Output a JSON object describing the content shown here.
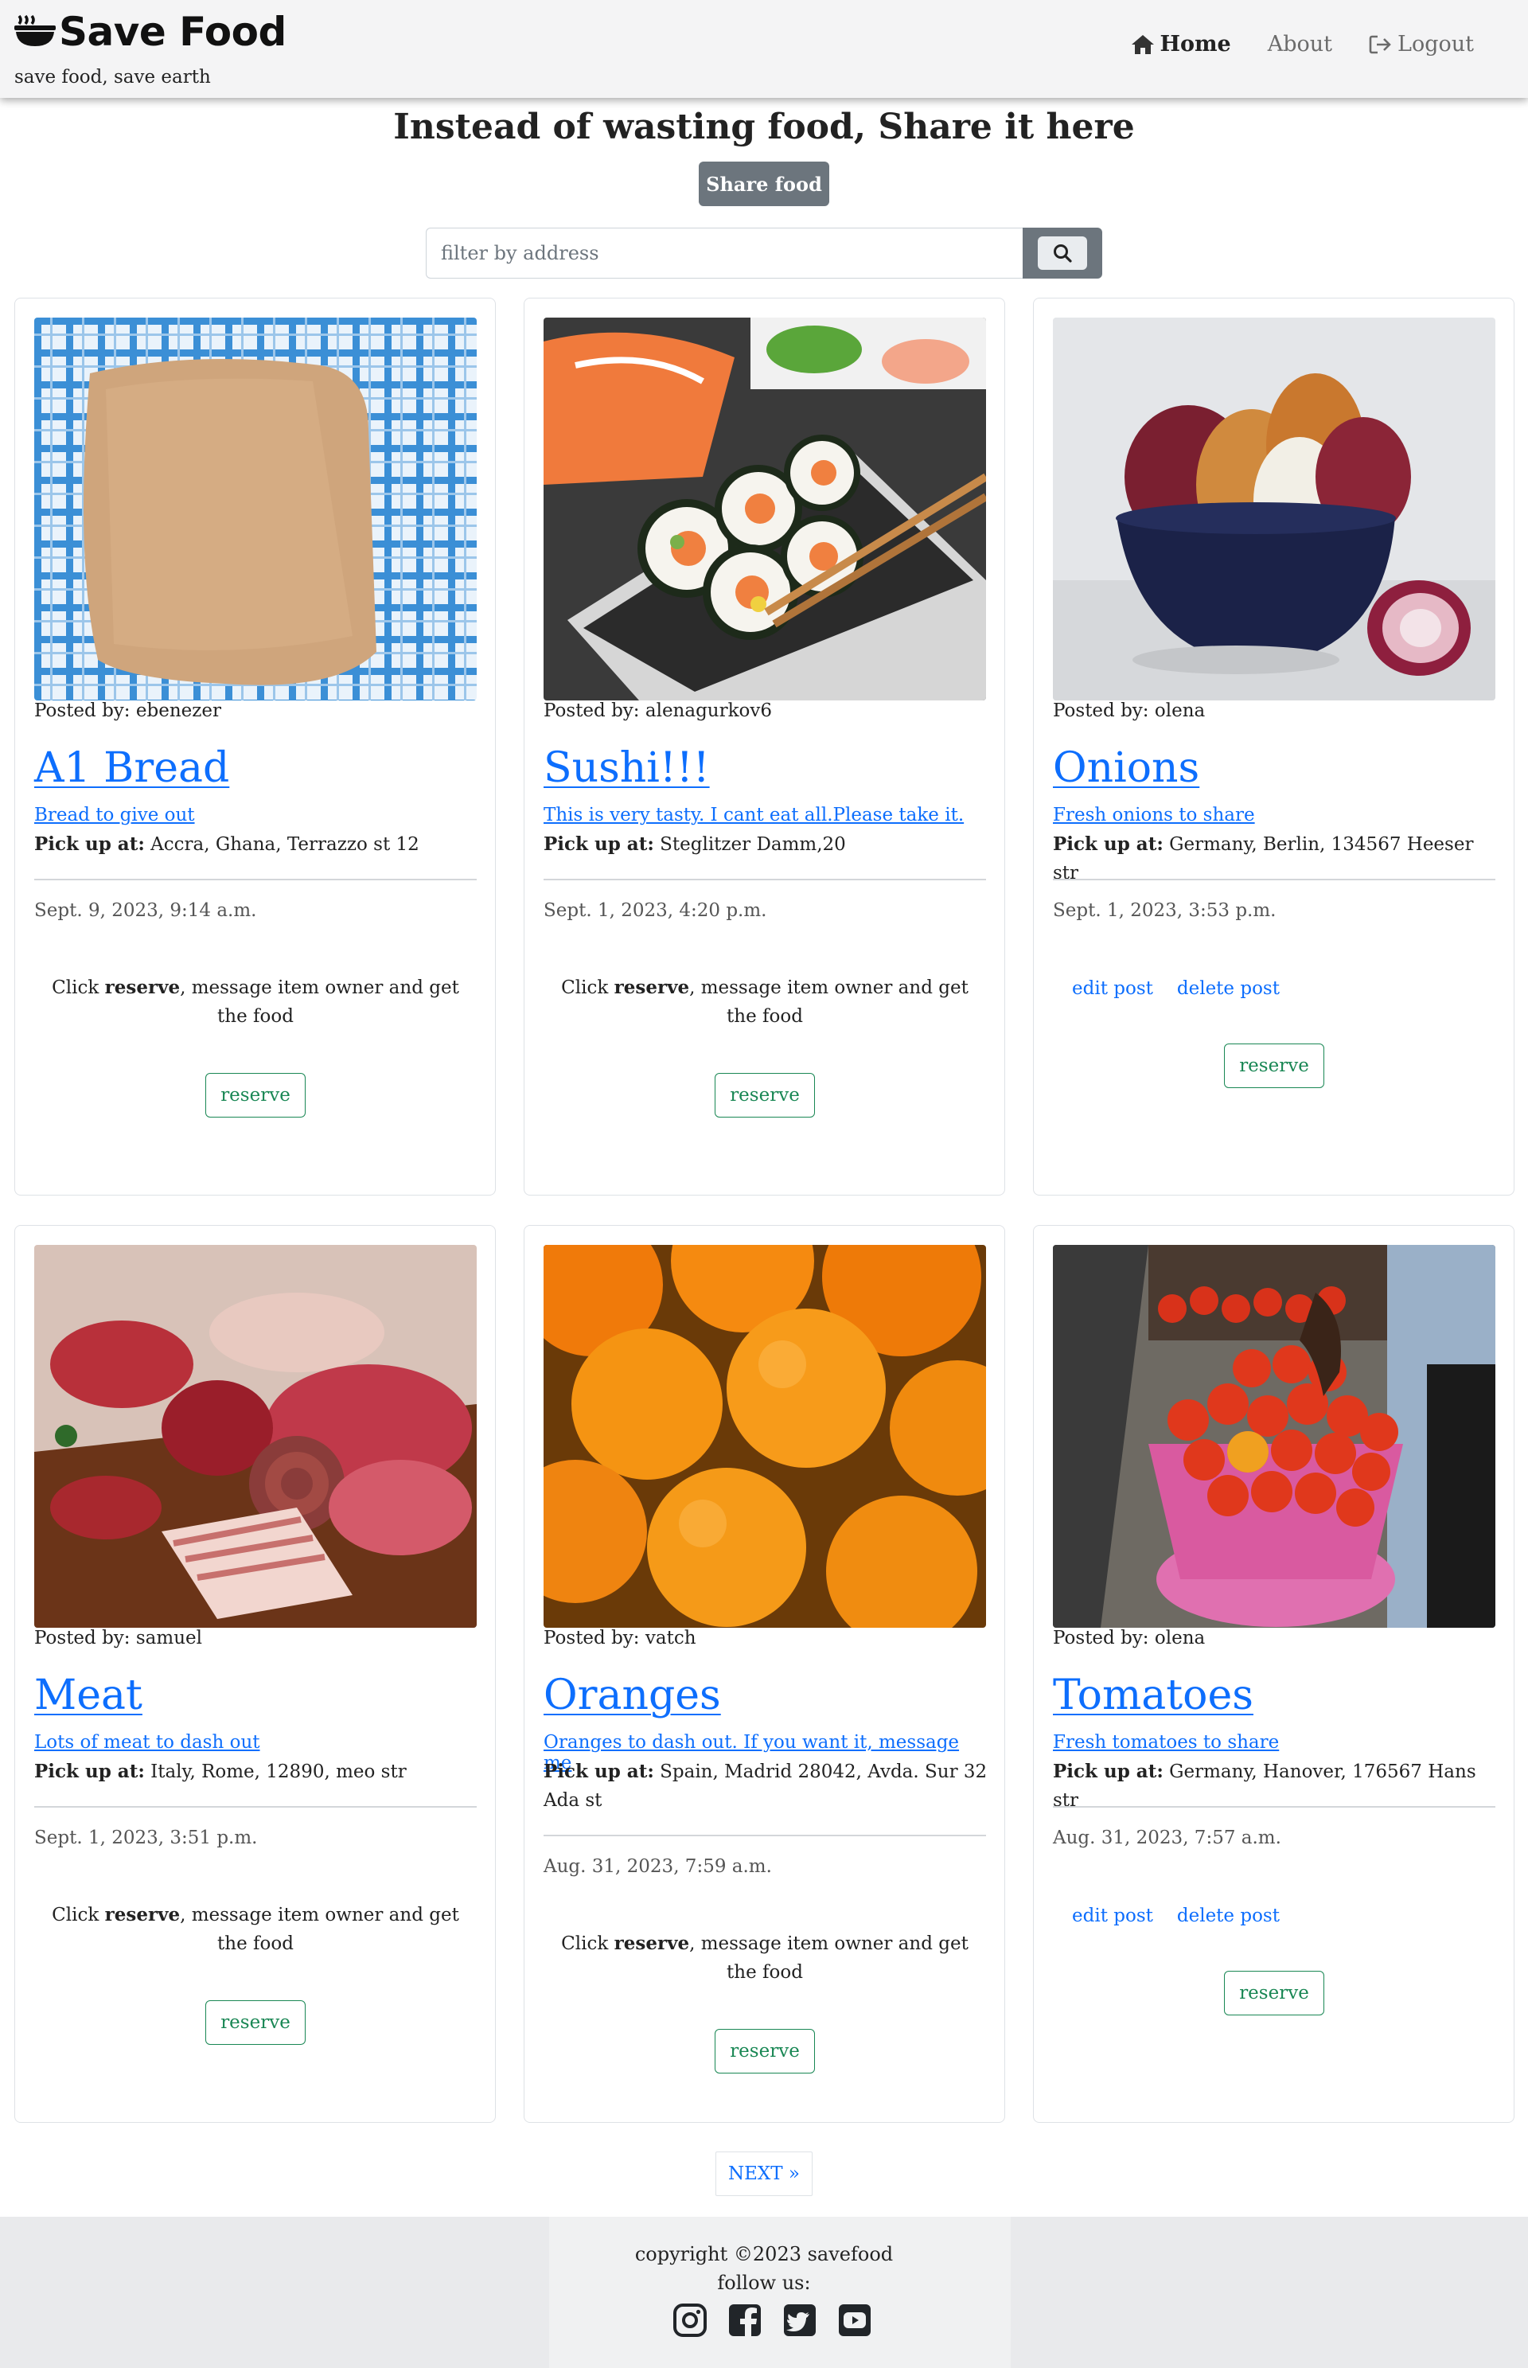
{
  "nav": {
    "brand": "Save Food",
    "tagline": "save food, save earth",
    "links": [
      {
        "label": "Home",
        "icon": "home-icon"
      },
      {
        "label": "About"
      },
      {
        "label": "Logout",
        "icon": "logout-icon"
      }
    ]
  },
  "hero": {
    "title": "Instead of wasting food, Share it here",
    "share_label": "Share food"
  },
  "search": {
    "placeholder": "filter by address",
    "value": ""
  },
  "common": {
    "posted_prefix": "Posted by:",
    "pickup_label": "Pick up at:",
    "hint_pre": "Click ",
    "hint_bold": "reserve",
    "hint_post": ", message item owner and get the food",
    "reserve_label": "reserve",
    "edit_label": "edit post",
    "delete_label": "delete post"
  },
  "posts": [
    {
      "image": "bread-photo",
      "poster": "ebenezer",
      "title": "A1 Bread",
      "description": "Bread to give out",
      "pickup": "Accra, Ghana, Terrazzo st 12",
      "date": "Sept. 9, 2023, 9:14 a.m.",
      "owner": false
    },
    {
      "image": "sushi-photo",
      "poster": "alenagurkov6",
      "title": "Sushi!!!",
      "description": "This is very tasty. I cant eat all.Please take it.",
      "pickup": "Steglitzer Damm,20",
      "date": "Sept. 1, 2023, 4:20 p.m.",
      "owner": false
    },
    {
      "image": "onions-photo",
      "poster": "olena",
      "title": "Onions",
      "description": "Fresh onions to share",
      "pickup": "Germany, Berlin, 134567 Heeser str",
      "date": "Sept. 1, 2023, 3:53 p.m.",
      "owner": true
    },
    {
      "image": "meat-photo",
      "poster": "samuel",
      "title": "Meat",
      "description": "Lots of meat to dash out",
      "pickup": "Italy, Rome, 12890, meo str",
      "date": "Sept. 1, 2023, 3:51 p.m.",
      "owner": false
    },
    {
      "image": "oranges-photo",
      "poster": "vatch",
      "title": "Oranges",
      "description": "Oranges to dash out. If you want it, message me",
      "pickup": "Spain, Madrid 28042, Avda. Sur 32 Ada st",
      "date": "Aug. 31, 2023, 7:59 a.m.",
      "owner": false
    },
    {
      "image": "tomatoes-photo",
      "poster": "olena",
      "title": "Tomatoes",
      "description": "Fresh tomatoes to share",
      "pickup": "Germany, Hanover, 176567 Hans str",
      "date": "Aug. 31, 2023, 7:57 a.m.",
      "owner": true
    }
  ],
  "pagination": {
    "next_label": "NEXT »"
  },
  "footer": {
    "copyright": "copyright ©2023 savefood",
    "follow": "follow us:",
    "socials": [
      "instagram-icon",
      "facebook-icon",
      "twitter-icon",
      "youtube-icon"
    ]
  }
}
